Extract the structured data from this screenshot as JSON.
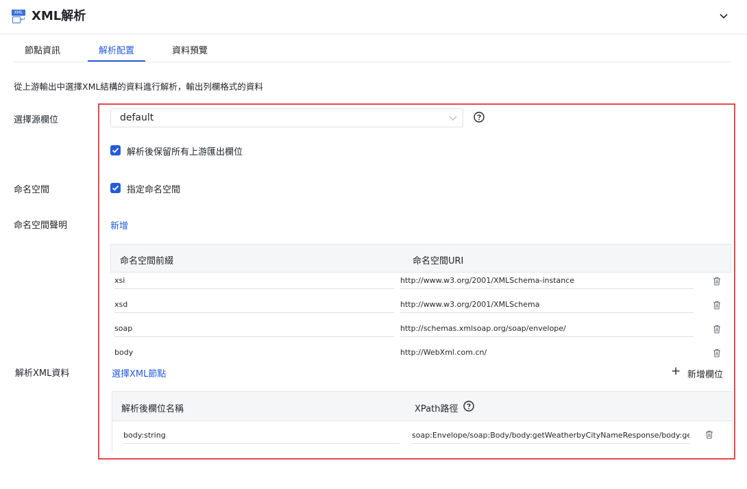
{
  "header": {
    "icon_tag": "XML",
    "title": "XML解析"
  },
  "tabs": [
    {
      "label": "節點資訊"
    },
    {
      "label": "解析配置"
    },
    {
      "label": "資料預覽"
    }
  ],
  "description": "從上游輸出中選擇XML結構的資料進行解析，輸出列欄格式的資料",
  "labels": {
    "source_field": "選擇源欄位",
    "namespace": "命名空間",
    "namespace_declaration": "命名空間聲明",
    "parse_xml_data": "解析XML資料"
  },
  "source_select": {
    "value": "default"
  },
  "keep_fields_checkbox": {
    "checked": true,
    "label": "解析後保留所有上游匯出欄位"
  },
  "namespace_checkbox": {
    "checked": true,
    "label": "指定命名空間"
  },
  "namespace_add_link": "新增",
  "namespace_table": {
    "columns": [
      "命名空間前綴",
      "命名空間URI"
    ],
    "rows": [
      {
        "prefix": "xsi",
        "uri": "http://www.w3.org/2001/XMLSchema-instance"
      },
      {
        "prefix": "xsd",
        "uri": "http://www.w3.org/2001/XMLSchema"
      },
      {
        "prefix": "soap",
        "uri": "http://schemas.xmlsoap.org/soap/envelope/"
      },
      {
        "prefix": "body",
        "uri": "http://WebXml.com.cn/"
      }
    ]
  },
  "select_xml_node_link": "選擇XML節點",
  "add_field_button": {
    "icon": "plus-icon",
    "label": "新增欄位"
  },
  "xpath_table": {
    "columns": [
      "解析後欄位名稱",
      "XPath路徑"
    ],
    "rows": [
      {
        "field": "body:string",
        "xpath": "soap:Envelope/soap:Body/body:getWeatherbyCityNameResponse/body:getWeat..."
      }
    ]
  },
  "colors": {
    "accent": "#245bdb",
    "highlight_frame": "#e5484d",
    "text": "#1f2329"
  }
}
